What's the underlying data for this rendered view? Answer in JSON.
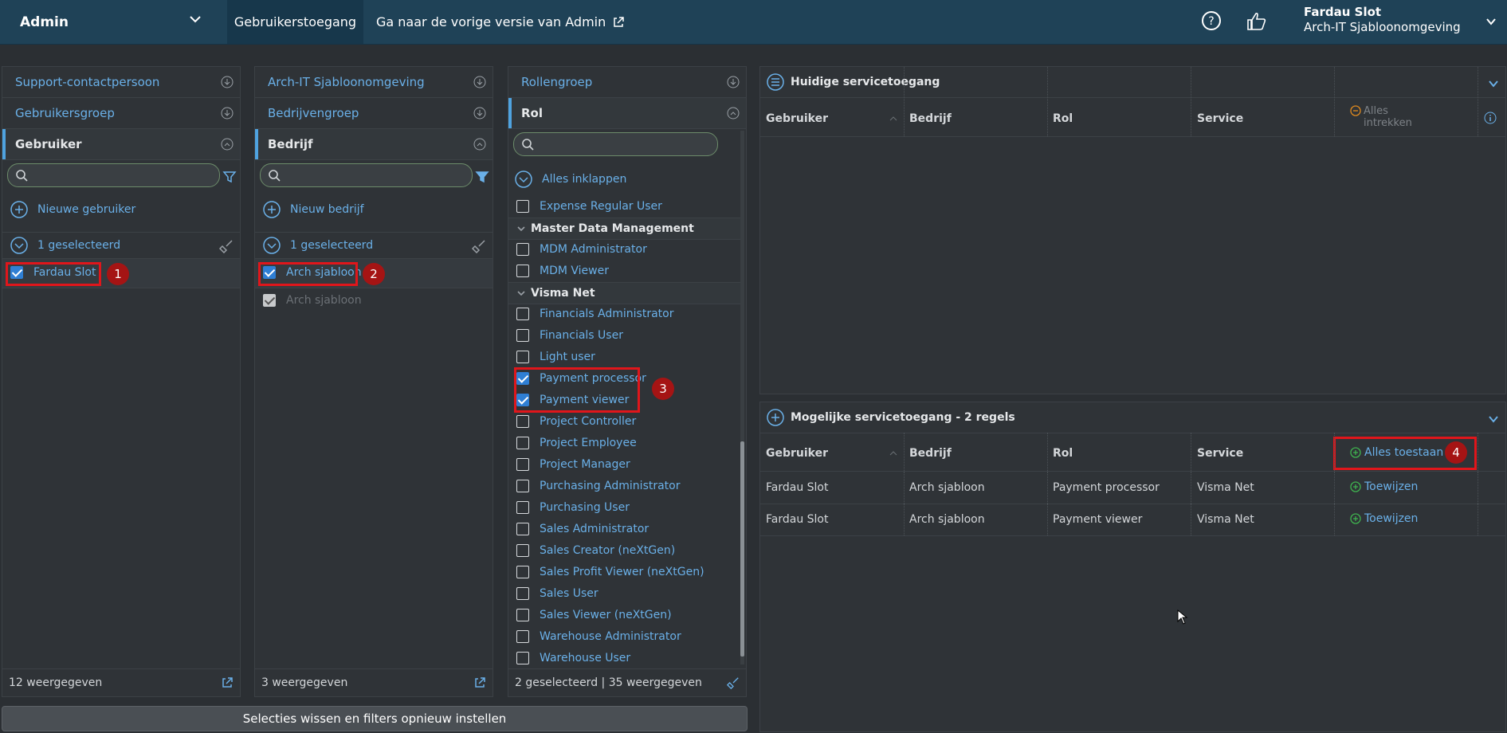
{
  "topbar": {
    "app": "Admin",
    "active_tab": "Gebruikerstoegang",
    "prev_link": "Ga naar de vorige versie van Admin",
    "user_name": "Fardau Slot",
    "user_org": "Arch-IT Sjabloonomgeving"
  },
  "col1": {
    "hdr1": "Support-contactpersoon",
    "hdr2": "Gebruikersgroep",
    "hdr3": "Gebruiker",
    "new": "Nieuwe gebruiker",
    "selected": "1 geselecteerd",
    "item": "Fardau Slot",
    "footer": "12 weergegeven"
  },
  "col2": {
    "hdr1": "Arch-IT Sjabloonomgeving",
    "hdr2": "Bedrijvengroep",
    "hdr3": "Bedrijf",
    "new": "Nieuw bedrijf",
    "selected": "1 geselecteerd",
    "item": "Arch sjabloon",
    "item_disabled": "Arch sjabloon",
    "footer": "3 weergegeven"
  },
  "col3": {
    "hdr1": "Rollengroep",
    "hdr2": "Rol",
    "collapse_all": "Alles inklappen",
    "footer": "2 geselecteerd | 35 weergegeven",
    "roles_top": [
      "Expense Regular User"
    ],
    "group_mdm": "Master Data Management",
    "roles_mdm": [
      "MDM Administrator",
      "MDM Viewer"
    ],
    "group_visma": "Visma Net",
    "roles_visma": [
      {
        "label": "Financials Administrator",
        "checked": false
      },
      {
        "label": "Financials User",
        "checked": false
      },
      {
        "label": "Light user",
        "checked": false
      },
      {
        "label": "Payment processor",
        "checked": true
      },
      {
        "label": "Payment viewer",
        "checked": true
      },
      {
        "label": "Project Controller",
        "checked": false
      },
      {
        "label": "Project Employee",
        "checked": false
      },
      {
        "label": "Project Manager",
        "checked": false
      },
      {
        "label": "Purchasing Administrator",
        "checked": false
      },
      {
        "label": "Purchasing User",
        "checked": false
      },
      {
        "label": "Sales Administrator",
        "checked": false
      },
      {
        "label": "Sales Creator (neXtGen)",
        "checked": false
      },
      {
        "label": "Sales Profit Viewer (neXtGen)",
        "checked": false
      },
      {
        "label": "Sales User",
        "checked": false
      },
      {
        "label": "Sales Viewer (neXtGen)",
        "checked": false
      },
      {
        "label": "Warehouse Administrator",
        "checked": false
      },
      {
        "label": "Warehouse User",
        "checked": false
      }
    ]
  },
  "current": {
    "title": "Huidige servicetoegang",
    "cols": [
      "Gebruiker",
      "Bedrijf",
      "Rol",
      "Service"
    ],
    "revoke_all": "Alles intrekken"
  },
  "possible": {
    "title": "Mogelijke servicetoegang - 2 regels",
    "cols": [
      "Gebruiker",
      "Bedrijf",
      "Rol",
      "Service"
    ],
    "allow_all": "Alles toestaan",
    "rows": [
      {
        "user": "Fardau Slot",
        "company": "Arch sjabloon",
        "role": "Payment processor",
        "service": "Visma Net",
        "action": "Toewijzen"
      },
      {
        "user": "Fardau Slot",
        "company": "Arch sjabloon",
        "role": "Payment viewer",
        "service": "Visma Net",
        "action": "Toewijzen"
      }
    ]
  },
  "badges": [
    "1",
    "2",
    "3",
    "4"
  ],
  "reset_button": "Selecties wissen en filters opnieuw instellen",
  "colors": {
    "accent": "#6ab0e8",
    "highlight": "#e0161b",
    "badge": "#a51414",
    "topbar": "#1f4257"
  }
}
